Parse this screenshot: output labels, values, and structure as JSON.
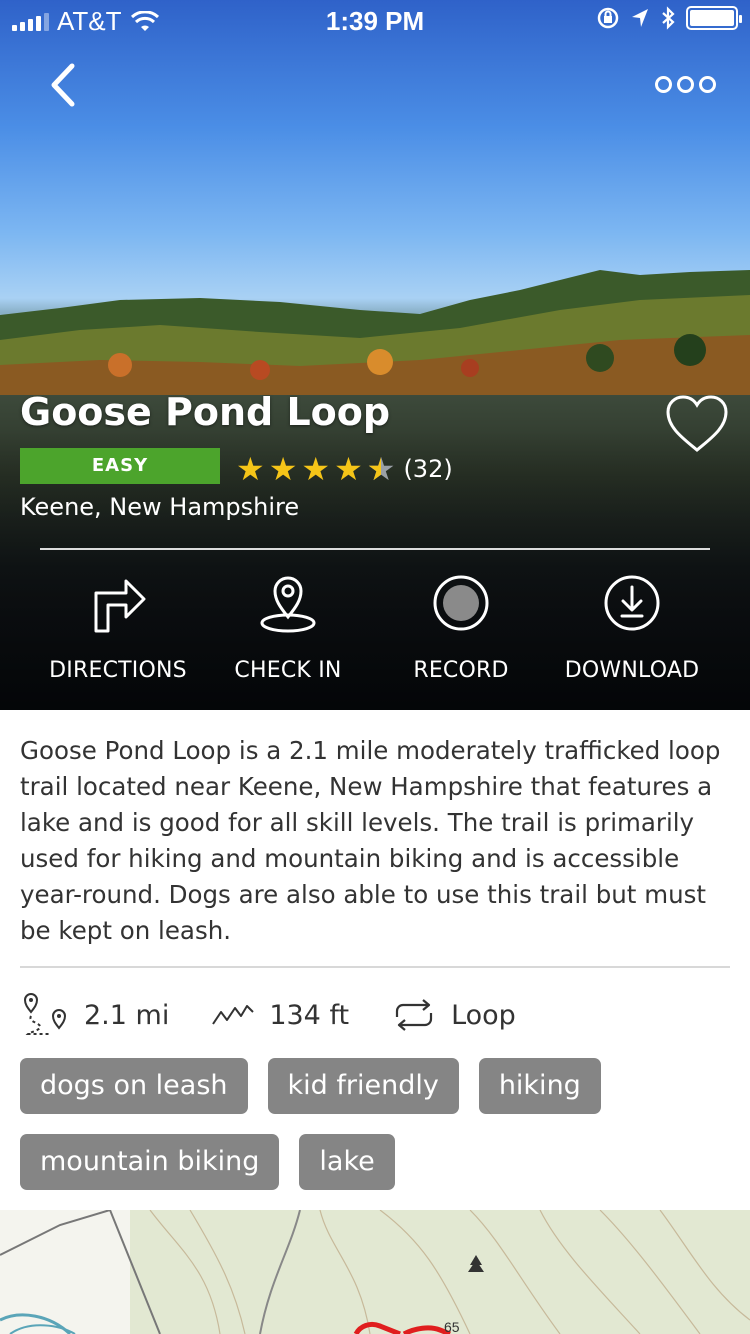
{
  "status_bar": {
    "carrier": "AT&T",
    "time": "1:39 PM"
  },
  "trail": {
    "name": "Goose Pond Loop",
    "difficulty": "EASY",
    "rating": 4.5,
    "review_count": "(32)",
    "location": "Keene, New Hampshire",
    "favorited": false
  },
  "actions": [
    {
      "label": "DIRECTIONS",
      "icon": "directions-icon"
    },
    {
      "label": "CHECK IN",
      "icon": "location-pin-icon"
    },
    {
      "label": "RECORD",
      "icon": "record-icon"
    },
    {
      "label": "DOWNLOAD",
      "icon": "download-icon"
    }
  ],
  "description": "Goose Pond Loop is a 2.1 mile moderately trafficked loop trail located near Keene, New Hampshire that features a lake and is good for all skill levels. The trail is primarily used for hiking and mountain biking and is accessible year-round. Dogs are also able to use this trail but must be kept on leash.",
  "stats": {
    "distance": "2.1 mi",
    "elevation": "134 ft",
    "route_type": "Loop"
  },
  "tags": [
    "dogs on leash",
    "kid friendly",
    "hiking",
    "mountain biking",
    "lake"
  ],
  "colors": {
    "difficulty_easy": "#4ca42c",
    "star": "#f5c518",
    "tag_bg": "#858585",
    "map_bg": "#e6ead7",
    "route": "#e01e1e"
  }
}
